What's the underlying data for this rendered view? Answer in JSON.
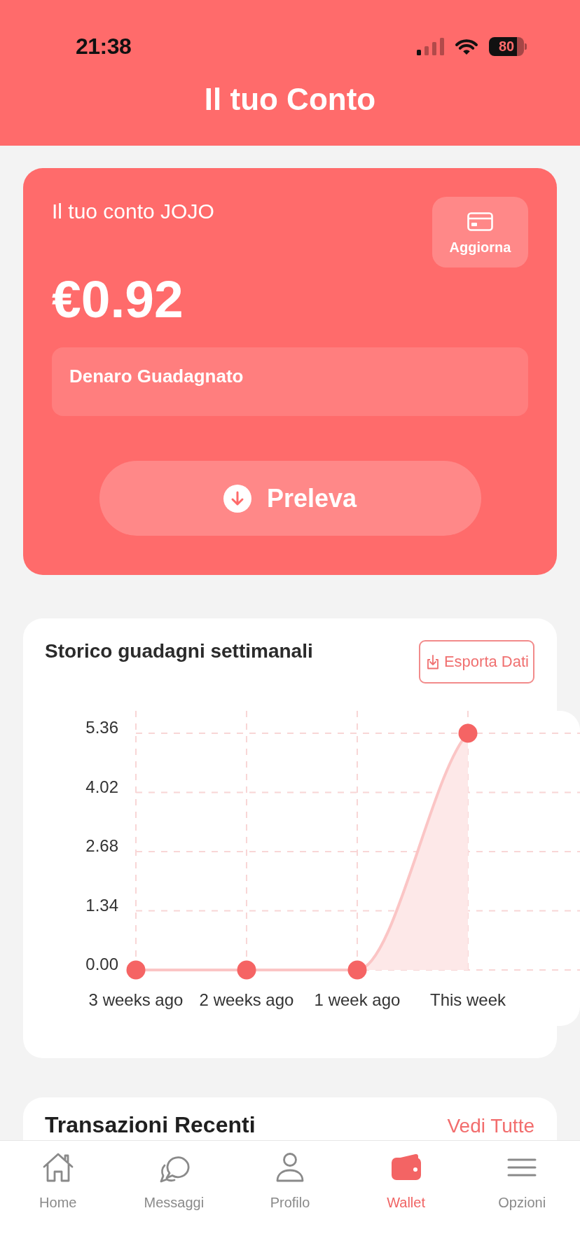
{
  "status_bar": {
    "time": "21:38",
    "battery": "80"
  },
  "header": {
    "title": "Il tuo Conto"
  },
  "balance_card": {
    "label": "Il tuo conto JOJO",
    "refresh_button": "Aggiorna",
    "amount": "€0.92",
    "earned_panel": "Denaro Guadagnato",
    "withdraw_button": "Preleva"
  },
  "earnings_chart": {
    "title": "Storico guadagni settimanali",
    "export_button": "Esporta Dati",
    "chart_data": {
      "type": "area",
      "grid": true,
      "categories": [
        "3 weeks ago",
        "2 weeks ago",
        "1 week ago",
        "This week"
      ],
      "values": [
        0,
        0,
        0,
        5.36
      ],
      "ylim": [
        0,
        5.36
      ],
      "yticks": [
        {
          "value": 0,
          "label": "0.00"
        },
        {
          "value": 1.34,
          "label": "1.34"
        },
        {
          "value": 2.68,
          "label": "2.68"
        },
        {
          "value": 4.02,
          "label": "4.02"
        },
        {
          "value": 5.36,
          "label": "5.36"
        }
      ]
    }
  },
  "recent_transactions": {
    "title": "Transazioni Recenti",
    "see_all_link": "Vedi Tutte"
  },
  "tab_bar": {
    "items": [
      {
        "label": "Home",
        "selected": false
      },
      {
        "label": "Messaggi",
        "selected": false
      },
      {
        "label": "Profilo",
        "selected": false
      },
      {
        "label": "Wallet",
        "selected": true
      },
      {
        "label": "Opzioni",
        "selected": false
      }
    ]
  }
}
